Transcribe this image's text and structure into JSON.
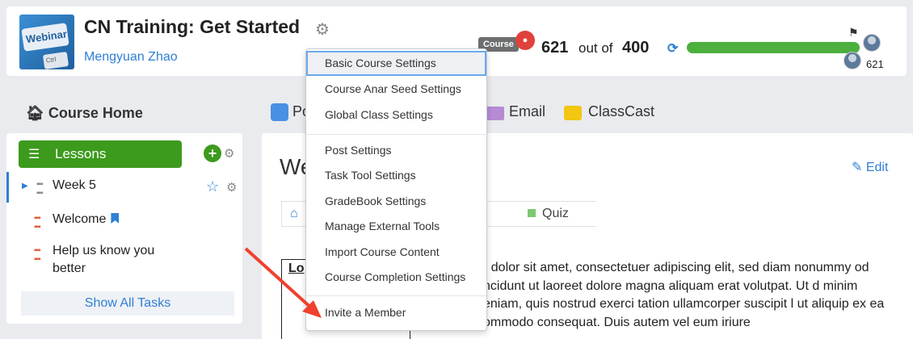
{
  "header": {
    "logo_text": "Webinar",
    "logo_key2": "Ctrl",
    "course_title": "CN Training: Get Started",
    "author": "Mengyuan Zhao",
    "badge": "Course",
    "score": "621",
    "out_of": "out of",
    "total": "400",
    "rank_score": "621",
    "progress_fraction": 1.0
  },
  "sidebar": {
    "home_label": "Course Home",
    "lessons_label": "Lessons",
    "items": [
      {
        "label": "Week 5"
      },
      {
        "label": "Welcome"
      },
      {
        "label": "Help us know you better"
      }
    ],
    "show_all": "Show All Tasks"
  },
  "nav": {
    "post": "Po",
    "email": "Email",
    "classcast": "ClassCast"
  },
  "main": {
    "title": "We",
    "edit": "Edit",
    "crumb_quiz": "Quiz",
    "lo_text": "Lo",
    "lorem": "m dolor sit amet, consectetuer adipiscing elit, sed diam nonummy od tincidunt ut laoreet dolore magna aliquam erat volutpat. Ut d minim veniam, quis nostrud exerci tation ullamcorper suscipit l ut aliquip ex ea commodo consequat. Duis autem vel eum iriure"
  },
  "dropdown": {
    "items": [
      "Basic Course Settings",
      "Course Anar Seed Settings",
      "Global Class Settings",
      "Post Settings",
      "Task Tool Settings",
      "GradeBook Settings",
      "Manage External Tools",
      "Import Course Content",
      "Course Completion Settings",
      "Invite a Member"
    ]
  },
  "colors": {
    "accent": "#2f7fd4",
    "green": "#3c9a1d",
    "progress": "#4caf3e",
    "arrow": "#f0402e"
  },
  "icons": [
    "gear-icon",
    "seed-icon",
    "refresh-icon",
    "flag-icon",
    "home-icon",
    "list-icon",
    "add-icon",
    "star-icon",
    "bookmark-icon",
    "pencil-icon",
    "email-icon",
    "camera-icon"
  ]
}
